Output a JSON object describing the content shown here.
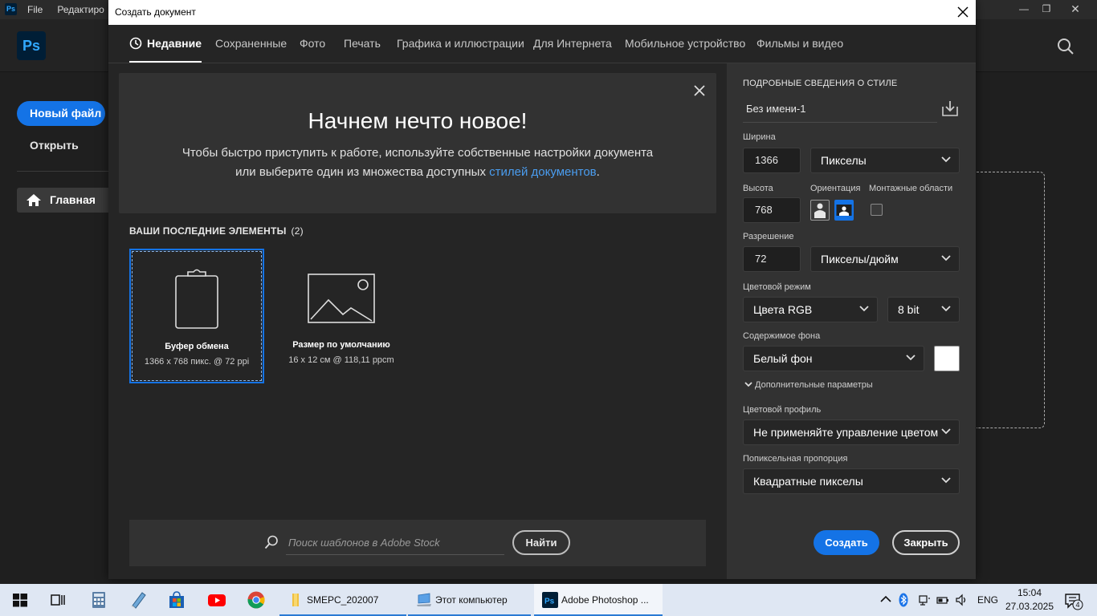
{
  "app": {
    "logo": "Ps",
    "menu": [
      "File",
      "Редактиро"
    ],
    "sidebar": {
      "new_file": "Новый файл",
      "open": "Открыть",
      "home": "Главная"
    }
  },
  "dialog": {
    "title": "Создать документ",
    "tabs": [
      {
        "label": "Недавние",
        "active": true
      },
      {
        "label": "Сохраненные"
      },
      {
        "label": "Фото"
      },
      {
        "label": "Печать"
      },
      {
        "label": "Графика и иллюстрации"
      },
      {
        "label": "Для Интернета"
      },
      {
        "label": "Мобильное устройство"
      },
      {
        "label": "Фильмы и видео"
      }
    ],
    "welcome": {
      "title": "Начнем нечто новое!",
      "text_1": "Чтобы быстро приступить к работе, используйте собственные настройки документа или выберите один из множества доступных ",
      "link": "стилей документов",
      "text_2": "."
    },
    "recent": {
      "heading": "ВАШИ ПОСЛЕДНИЕ ЭЛЕМЕНТЫ",
      "count": "(2)",
      "items": [
        {
          "name": "Буфер обмена",
          "meta": "1366 x 768 пикс. @ 72 ppi",
          "icon": "clipboard-icon",
          "selected": true
        },
        {
          "name": "Размер по умолчанию",
          "meta": "16 x 12 см @ 118,11 ppcm",
          "icon": "image-icon"
        }
      ]
    },
    "stock": {
      "placeholder": "Поиск шаблонов в Adobe Stock",
      "button": "Найти"
    },
    "details": {
      "heading": "ПОДРОБНЫЕ СВЕДЕНИЯ О СТИЛЕ",
      "preset_name": "Без имени-1",
      "width_label": "Ширина",
      "width_value": "1366",
      "width_unit": "Пикселы",
      "height_label": "Высота",
      "height_value": "768",
      "orientation_label": "Ориентация",
      "orientation": "landscape",
      "artboards_label": "Монтажные области",
      "artboards": false,
      "resolution_label": "Разрешение",
      "resolution_value": "72",
      "resolution_unit": "Пикселы/дюйм",
      "color_mode_label": "Цветовой режим",
      "color_mode": "Цвета RGB",
      "bit_depth": "8 bit",
      "background_label": "Содержимое фона",
      "background": "Белый фон",
      "background_color": "#ffffff",
      "advanced_label": "Дополнительные параметры",
      "color_profile_label": "Цветовой профиль",
      "color_profile": "Не применяйте управление цветом",
      "pixel_aspect_label": "Попиксельная пропорция",
      "pixel_aspect": "Квадратные пикселы",
      "create_button": "Создать",
      "close_button": "Закрыть"
    }
  },
  "taskbar": {
    "apps": [
      {
        "label": "SMEPC_202007",
        "icon": "folder-icon"
      },
      {
        "label": "Этот компьютер",
        "icon": "computer-icon"
      },
      {
        "label": "Adobe Photoshop ...",
        "icon": "photoshop-icon",
        "active": true
      }
    ],
    "lang": "ENG",
    "time": "15:04",
    "date": "27.03.2025",
    "notifications": "4"
  },
  "colors": {
    "accent": "#1473e6",
    "link": "#4a9df0",
    "panel": "#323232",
    "dialog_bg": "#252525"
  }
}
